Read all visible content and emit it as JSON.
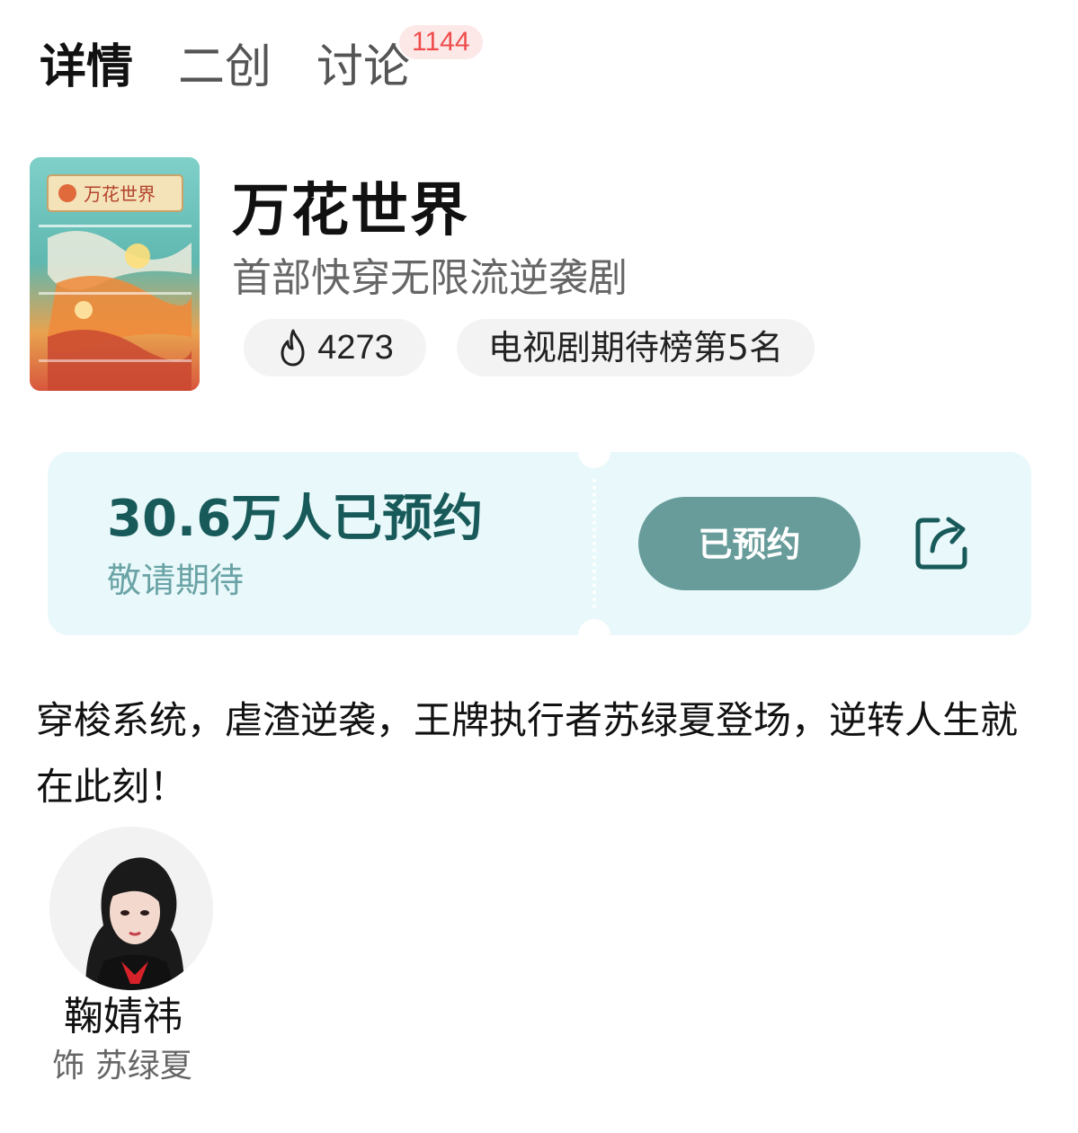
{
  "tabs": [
    {
      "label": "详情",
      "active": true
    },
    {
      "label": "二创",
      "active": false
    },
    {
      "label": "讨论",
      "active": false
    }
  ],
  "discussion_badge": "1144",
  "show": {
    "title": "万花世界",
    "subtitle": "首部快穿无限流逆袭剧",
    "poster_text": "万花世界",
    "heat_icon": "flame-icon",
    "heat_value": "4273",
    "rank_label": "电视剧期待榜第5名"
  },
  "reservation": {
    "count_text": "30.6万人已预约",
    "status_text": "敬请期待",
    "button_label": "已预约",
    "share_icon": "share-icon",
    "accent_color": "#185a5a",
    "button_color": "#679c9a",
    "card_color": "#e9f8fa"
  },
  "description": "穿梭系统，虐渣逆袭，王牌执行者苏绿夏登场，逆转人生就在此刻！",
  "cast": [
    {
      "name": "鞠婧祎",
      "role": "饰 苏绿夏"
    }
  ]
}
